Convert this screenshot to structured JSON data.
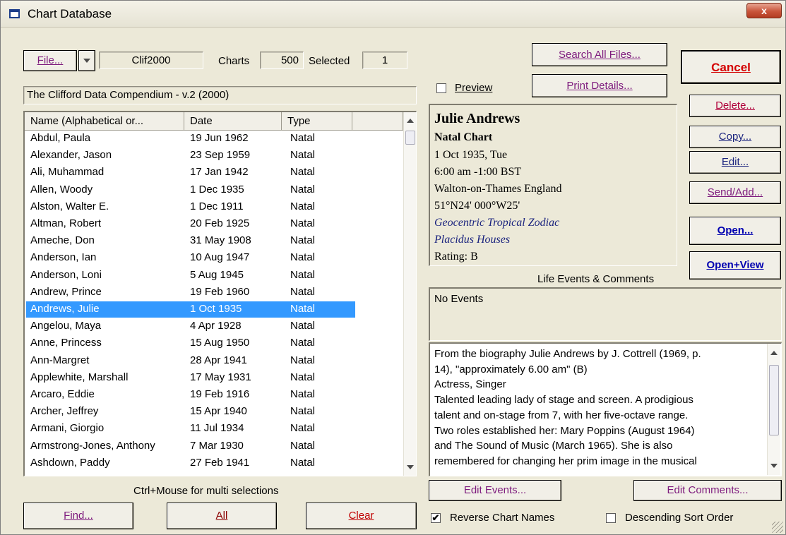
{
  "window": {
    "title": "Chart Database",
    "close": "x"
  },
  "file_bar": {
    "file_button": "File...",
    "file_name": "Clif2000",
    "charts_label": "Charts",
    "charts_count": "500",
    "selected_label": "Selected",
    "selected_count": "1"
  },
  "database_name": "The Clifford Data Compendium - v.2 (2000)",
  "list": {
    "columns": [
      "Name (Alphabetical or...",
      "Date",
      "Type"
    ],
    "rows": [
      {
        "name": "Abdul, Paula",
        "date": "19 Jun 1962",
        "type": "Natal"
      },
      {
        "name": "Alexander, Jason",
        "date": "23 Sep 1959",
        "type": "Natal"
      },
      {
        "name": "Ali, Muhammad",
        "date": "17 Jan 1942",
        "type": "Natal"
      },
      {
        "name": "Allen, Woody",
        "date": "1 Dec 1935",
        "type": "Natal"
      },
      {
        "name": "Alston, Walter E.",
        "date": "1 Dec 1911",
        "type": "Natal"
      },
      {
        "name": "Altman, Robert",
        "date": "20 Feb 1925",
        "type": "Natal"
      },
      {
        "name": "Ameche, Don",
        "date": "31 May 1908",
        "type": "Natal"
      },
      {
        "name": "Anderson, Ian",
        "date": "10 Aug 1947",
        "type": "Natal"
      },
      {
        "name": "Anderson, Loni",
        "date": "5 Aug 1945",
        "type": "Natal"
      },
      {
        "name": "Andrew, Prince",
        "date": "19 Feb 1960",
        "type": "Natal"
      },
      {
        "name": "Andrews, Julie",
        "date": "1 Oct 1935",
        "type": "Natal"
      },
      {
        "name": "Angelou, Maya",
        "date": "4 Apr 1928",
        "type": "Natal"
      },
      {
        "name": "Anne, Princess",
        "date": "15 Aug 1950",
        "type": "Natal"
      },
      {
        "name": "Ann-Margret",
        "date": "28 Apr 1941",
        "type": "Natal"
      },
      {
        "name": "Applewhite, Marshall",
        "date": "17 May 1931",
        "type": "Natal"
      },
      {
        "name": "Arcaro, Eddie",
        "date": "19 Feb 1916",
        "type": "Natal"
      },
      {
        "name": "Archer, Jeffrey",
        "date": "15 Apr 1940",
        "type": "Natal"
      },
      {
        "name": "Armani, Giorgio",
        "date": "11 Jul 1934",
        "type": "Natal"
      },
      {
        "name": "Armstrong-Jones, Anthony",
        "date": "7 Mar 1930",
        "type": "Natal"
      },
      {
        "name": "Ashdown, Paddy",
        "date": "27 Feb 1941",
        "type": "Natal"
      }
    ],
    "selected_index": 10
  },
  "multi_hint": "Ctrl+Mouse for multi selections",
  "bottom_buttons": {
    "find": "Find...",
    "all": "All",
    "clear": "Clear"
  },
  "top_buttons": {
    "search_all": "Search All Files...",
    "print_details": "Print Details..."
  },
  "preview": {
    "label": "Preview",
    "checked": false
  },
  "detail": {
    "name": "Julie Andrews",
    "chart_type": "Natal Chart",
    "date": "1 Oct 1935, Tue",
    "time": "6:00 am  -1:00 BST",
    "place": "Walton-on-Thames England",
    "coords": "51°N24' 000°W25'",
    "zodiac": "Geocentric Tropical Zodiac",
    "houses": "Placidus Houses",
    "rating": "Rating: B"
  },
  "life_events": {
    "label": "Life Events & Comments",
    "events_text": "No Events"
  },
  "comments": [
    "From the biography Julie Andrews by J. Cottrell (1969, p.",
    "14), \"approximately 6.00 am\" (B)",
    "Actress, Singer",
    "Talented leading lady of stage and screen.  A prodigious",
    "talent and on-stage from 7, with her five-octave range.",
    "Two roles established her: Mary Poppins (August 1964)",
    "and The Sound of Music (March 1965).  She is also",
    "remembered for changing her prim image in the musical"
  ],
  "edit_buttons": {
    "edit_events": "Edit Events...",
    "edit_comments": "Edit Comments..."
  },
  "options": {
    "reverse_names": "Reverse Chart Names",
    "reverse_checked": true,
    "descending": "Descending Sort Order",
    "descending_checked": false
  },
  "side_buttons": {
    "cancel": "Cancel",
    "delete": "Delete...",
    "copy": "Copy...",
    "edit": "Edit...",
    "send_add": "Send/Add...",
    "open": "Open...",
    "open_view": "Open+View"
  }
}
